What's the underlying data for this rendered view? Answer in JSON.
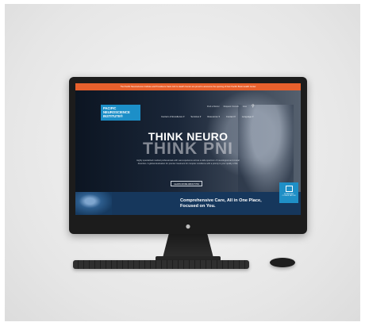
{
  "website": {
    "alert": "The Pacific Neuroscience Institute and Providence Saint John's Health Center are proud to announce the opening of their Pacific Brain Health Center",
    "logo": [
      "PACIFIC",
      "NEUROSCIENCE",
      "INSTITUTE®"
    ],
    "top_links": [
      "Find a Doctor",
      "Request Consult",
      "Give"
    ],
    "main_nav": [
      "Centers of Excellence",
      "Services",
      "Resources",
      "Contact",
      "Language"
    ],
    "headline_line1": "THINK NEURO",
    "headline_line2": "THINK PNI",
    "tagline": "Highly specialized medical professionals with vast experience across a wide spectrum of neurological and cranial disorders. A global destination for premier treatment for complex conditions with a priority to your quality of life.",
    "learn_button": "LEARN MORE ABOUT PNI",
    "band_text": "Comprehensive Care, All in One Place, Focused on You.",
    "schedule_label": "SCHEDULE CONSULTATION"
  },
  "device": {
    "apple_logo_glyph": "",
    "colors": {
      "alert_bar": "#e8602c",
      "logo_blue": "#1c8fc8",
      "band_navy": "#16375c"
    }
  }
}
